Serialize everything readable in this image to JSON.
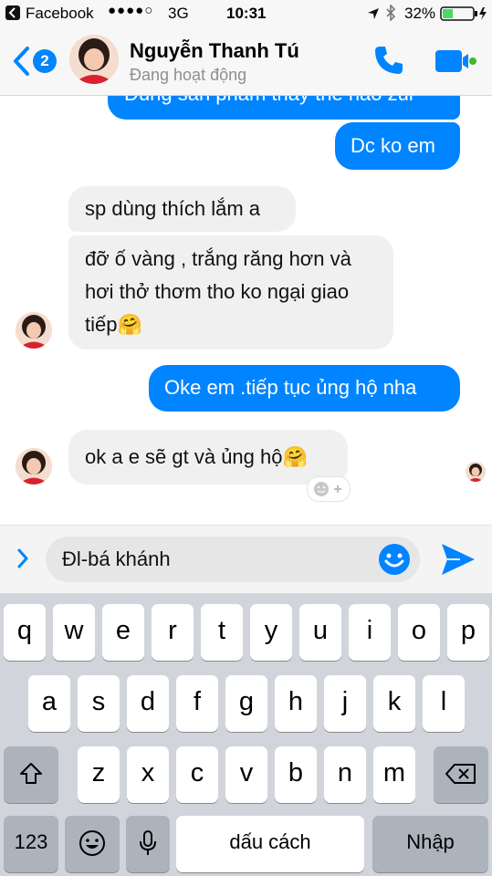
{
  "status_bar": {
    "back_app": "Facebook",
    "signal": "●●●●○",
    "network": "3G",
    "time": "10:31",
    "battery": "32%"
  },
  "header": {
    "unread_count": "2",
    "contact_name": "Nguyễn Thanh Tú",
    "contact_status": "Đang hoạt động"
  },
  "chat": {
    "messages": [
      {
        "from": "me",
        "text": "Dùng sản phẩm thấy thế nào zui"
      },
      {
        "from": "me",
        "text": "Dc ko em"
      },
      {
        "from": "them",
        "text": "sp dùng thích lắm a"
      },
      {
        "from": "them",
        "lines": [
          "đỡ ố vàng , trắng răng hơn và",
          "hơi thở thơm tho ko ngại giao",
          "tiếp🤗"
        ]
      },
      {
        "from": "me",
        "text": "Oke em .tiếp tục ủng hộ nha"
      },
      {
        "from": "them",
        "text": "ok a e sẽ gt và ủng hộ🤗"
      }
    ],
    "reaction_add_icon": "smiley-plus-icon"
  },
  "composer": {
    "text": "Đl-bá khánh"
  },
  "keyboard": {
    "row1": [
      "q",
      "w",
      "e",
      "r",
      "t",
      "y",
      "u",
      "i",
      "o",
      "p"
    ],
    "row2": [
      "a",
      "s",
      "d",
      "f",
      "g",
      "h",
      "j",
      "k",
      "l"
    ],
    "row3": [
      "z",
      "x",
      "c",
      "v",
      "b",
      "n",
      "m"
    ],
    "numbers_label": "123",
    "space_label": "dấu cách",
    "return_label": "Nhập"
  },
  "colors": {
    "accent": "#0084ff",
    "incoming_bubble": "#f1f0f0",
    "keyboard_bg": "#d1d5db"
  }
}
